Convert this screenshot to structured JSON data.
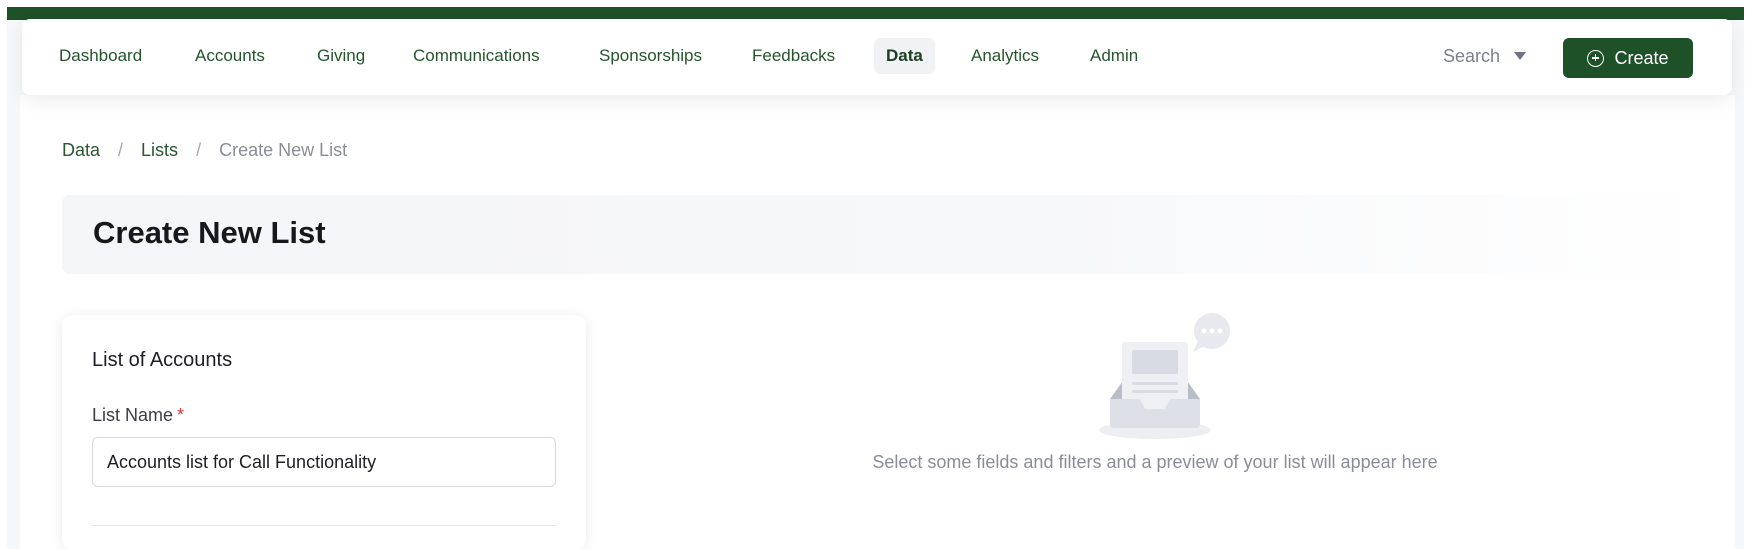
{
  "nav": {
    "items": [
      {
        "label": "Dashboard",
        "active": false
      },
      {
        "label": "Accounts",
        "active": false
      },
      {
        "label": "Giving",
        "active": false
      },
      {
        "label": "Communications",
        "active": false
      },
      {
        "label": "Sponsorships",
        "active": false
      },
      {
        "label": "Feedbacks",
        "active": false
      },
      {
        "label": "Data",
        "active": true
      },
      {
        "label": "Analytics",
        "active": false
      },
      {
        "label": "Admin",
        "active": false
      }
    ],
    "search_label": "Search",
    "create_label": "Create"
  },
  "breadcrumb": {
    "items": [
      "Data",
      "Lists"
    ],
    "separator": "/",
    "current": "Create New List"
  },
  "page": {
    "title": "Create New List"
  },
  "form": {
    "card_title": "List of Accounts",
    "list_name_label": "List Name",
    "required_marker": "*",
    "list_name_value": "Accounts list for Call Functionality"
  },
  "preview": {
    "empty_message": "Select some fields and filters and a preview of your list will appear here",
    "icon": "empty-inbox-chat-icon"
  },
  "colors": {
    "brand_green": "#1e5128",
    "nav_text": "#24542e",
    "required": "#d93a3a",
    "muted_text": "#8a8d97"
  }
}
